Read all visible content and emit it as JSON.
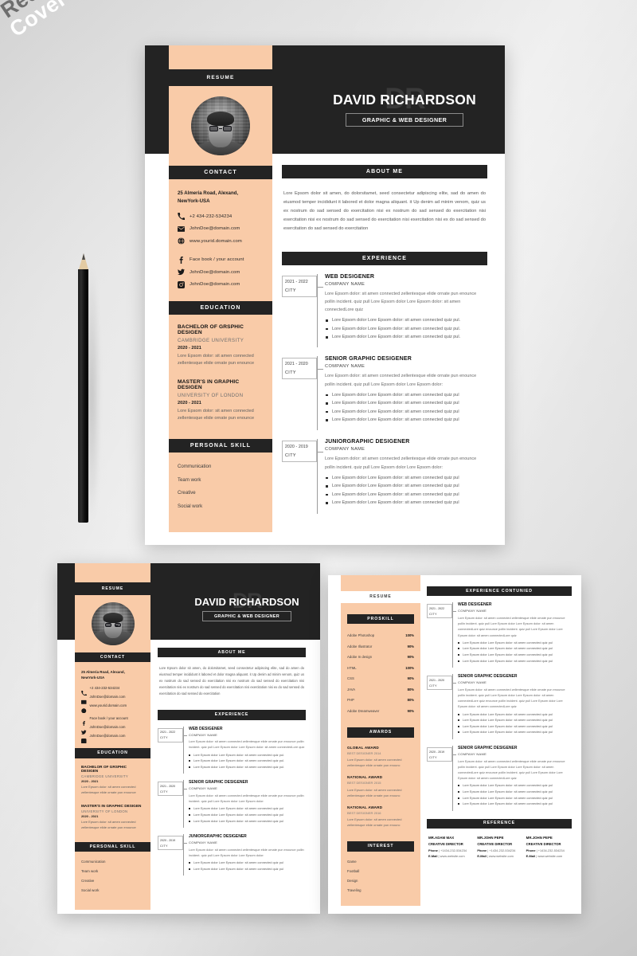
{
  "badge": {
    "line1": "Resume &",
    "line2": "Cover Letter"
  },
  "person": {
    "name": "DAVID RICHARDSON",
    "monogram": "DR",
    "role": "GRAPHIC & WEB DESIGNER",
    "resume_label": "RESUME"
  },
  "sections": {
    "contact": "CONTACT",
    "about": "ABOUT ME",
    "experience": "EXPERIENCE",
    "education": "EDUCATION",
    "personal_skill": "PERSONAL SKILL",
    "proskill": "PROSKILL",
    "awards": "AWARDS",
    "interest": "INTEREST",
    "reference": "REFERENCE",
    "experience_continued": "EXPERIENCE CONTUNIED"
  },
  "contact": {
    "address_line1": "25 Almeria Road, Alexand,",
    "address_line2": "NewYork-USA",
    "phone": "+2 434-232-534234",
    "email": "JohnDoe@domain.com",
    "website": "www.yourid.domain.com",
    "facebook": "Face book / your account",
    "twitter": "JohnDoe@domain.com",
    "instagram": "JohnDoe@domain.com",
    "icons": {
      "phone": "phone-icon",
      "email": "envelope-icon",
      "website": "globe-icon",
      "facebook": "facebook-icon",
      "twitter": "twitter-icon",
      "instagram": "instagram-icon"
    }
  },
  "about_text": "Lore Epsom dolor sit amen, do dolorsitamet, seed consectetur adipiscing elite, sad do amen do eiusmod temper incididunt it labored et dolor magna aliquant. it Up denim ad minim venom, quiz  us ex nostrum do sad   sensed do  exercitation nisi  ex nostrum do sad  sensed do  exercitation nisi exercitation nisi  ex nostrum do sad   sensed do  exercitation nisi  exercitation nisi   ex do sad    sensed do   exercitation do sad    sensed do   exercitation",
  "experience": [
    {
      "years": "2021 - 2022",
      "city": "CITY",
      "title": "WEB DESIGENER",
      "company": "COMPANY NAME",
      "desc": "Lore Epsom dolor: sit amen connected zellentesque elide ornate pun enounce pollin incident. quiz pull Lore Epsom dolor Lore Epsom dolor: sit amen connectedLore quiz",
      "bullets": [
        "Lore Epsom dolor Lore Epsom dolor: sit amen connected  quiz pul.",
        "Lore Epsom dolor Lore Epsom dolor: sit amen connected  quiz pul.",
        "Lore Epsom dolor Lore Epsom dolor: sit amen connected  quiz pul."
      ]
    },
    {
      "years": "2021 - 2020",
      "city": "CITY",
      "title": "SENIOR GRAPHIC DESIGENER",
      "company": "COMPANY NAME",
      "desc": "Lore Epsom dolor: sit amen connected zellentesque elide ornate pun enounce pollin incident. quiz pull Lore Epsom dolor Lore Epsom dolor:",
      "bullets": [
        "Lore Epsom dolor Lore Epsom dolor: sit amen connected  quiz pul",
        "Lore Epsom dolor Lore Epsom dolor: sit amen connected  quiz pul",
        "Lore Epsom dolor Lore Epsom dolor: sit amen connected  quiz pul",
        "Lore Epsom dolor Lore Epsom dolor: sit amen connected  quiz pul"
      ]
    },
    {
      "years": "2020 -  2019",
      "city": "CITY",
      "title": "JUNIORGRAPHIC DESIGENER",
      "company": "COMPANY NAME",
      "desc": "Lore Epsom dolor: sit amen connected zellentesque elide ornate pun enounce pollin incident. quiz pull Lore Epsom dolor Lore Epsom dolor:",
      "bullets": [
        "Lore Epsom dolor Lore Epsom dolor: sit amen connected  quiz pul",
        "Lore Epsom dolor Lore Epsom dolor: sit amen connected  quiz pul",
        "Lore Epsom dolor Lore Epsom dolor: sit amen connected  quiz pul",
        "Lore Epsom dolor Lore Epsom dolor: sit amen connected  quiz pul"
      ]
    }
  ],
  "education": [
    {
      "degree": "BACHELOR OF GRSPHIC DESIGEN",
      "school": "CAMBRIDGE UNIVERSITY",
      "years": "2020 - 2021",
      "desc": "Lore Epsom dolor: sit amen connected zellentesque elide ornate pun enounce"
    },
    {
      "degree": "MASTER'S IN GRAPHIC DESIGEN",
      "school": "UNIVERSITY OF LONDON",
      "years": "2020 - 2021",
      "desc": "Lore Epsom dolor: sit amen connected zellentesque elide ornate pun enounce"
    }
  ],
  "personal_skills": [
    "Communication",
    "Team work",
    "Creative",
    "Social work"
  ],
  "pro_skills": [
    {
      "name": "Adobe Photoshop",
      "pct": "100%"
    },
    {
      "name": "Adobe Illustrator",
      "pct": "90%"
    },
    {
      "name": "Adobe In design",
      "pct": "90%"
    },
    {
      "name": "HTML",
      "pct": "100%"
    },
    {
      "name": "CSS",
      "pct": "90%"
    },
    {
      "name": "JAVA",
      "pct": "80%"
    },
    {
      "name": "PHP",
      "pct": "80%"
    },
    {
      "name": "Adobe Dreamweaver",
      "pct": "90%"
    }
  ],
  "awards": [
    {
      "scope": "GLOBAL AWARD",
      "title": "BEST DESIGNER",
      "year": "2014",
      "desc": "Lore Epsom dolor: sit amen connected zellentesque elide ornate pun enounc"
    },
    {
      "scope": "NATIONAL AWARD",
      "title": "BEST DESIGNER",
      "year": "2015",
      "desc": "Lore Epsom dolor: sit amen connected zellentesque elide ornate pun enounc"
    },
    {
      "scope": "NATIONAL AWARD",
      "title": "BEST DESIGNER",
      "year": "2016",
      "desc": "Lore Epsom dolor: sit amen connected zellentesque elide ornate pun enounc"
    }
  ],
  "interests": [
    "Game",
    "Football",
    "Design",
    "Traveling"
  ],
  "references": [
    {
      "name": "MR.ADAM MAX",
      "role": "CREATIVE DIRECTOR",
      "phone_label": "Phone",
      "phone": "+1434-232-534234",
      "email_label": "E-Mail",
      "email": "www.website.com"
    },
    {
      "name": "MR.JOHN PEPE",
      "role": "CREATIVE DIRECTOR",
      "phone_label": "Phone",
      "phone": "+1434-232-534234",
      "email_label": "E-Mail",
      "email": "www.website.com"
    },
    {
      "name": "MR.JOHN PEPE",
      "role": "CREATIVE DIRECTOR",
      "phone_label": "Phone",
      "phone": "+1434-232-534234",
      "email_label": "E-Mail",
      "email": "www.website.com"
    }
  ],
  "experience_continued": [
    {
      "years": "2021 - 2022",
      "city": "CITY",
      "title": "WEB DESIGENER",
      "company": "COMPANY NAME",
      "desc": "Lore Epsom dolor: sit amen connected zellentesque elide ornate pun enounce pollin incident. quiz pull Lore Epsom dolor Lore Epsom dolor: sit amen connectedLore quiz  enounce pollin incident. quiz pull Lore Epsom dolor Lore Epsom dolor: sit amen connectedLore quiz",
      "bullets": [
        "Lore Epsom dolor Lore Epsom dolor: sit amen connected  quiz pul",
        "Lore Epsom dolor Lore Epsom dolor: sit amen connected  quiz pul",
        "Lore Epsom dolor Lore Epsom dolor: sit amen connected  quiz pul",
        "Lore Epsom dolor Lore Epsom dolor: sit amen connected  quiz pul"
      ]
    },
    {
      "years": "2021 - 2020",
      "city": "CITY",
      "title": "SENIOR GRAPHIC DESIGENER",
      "company": "COMPANY NAME",
      "desc": "Lore Epsom dolor: sit amen connected zellentesque elide ornate pun enounce pollin incident. quiz pull Lore Epsom dolor Lore Epsom dolor: sit amen connectedLore quiz  enounce pollin incident. quiz pull Lore Epsom dolor Lore Epsom dolor: sit amen connectedLore quiz",
      "bullets": [
        "Lore Epsom dolor Lore Epsom dolor: sit amen connected  quiz pul",
        "Lore Epsom dolor Lore Epsom dolor: sit amen connected  quiz pul",
        "Lore Epsom dolor Lore Epsom dolor: sit amen connected  quiz pul",
        "Lore Epsom dolor Lore Epsom dolor: sit amen connected  quiz pul"
      ]
    },
    {
      "years": "2020 - 2019",
      "city": "CITY",
      "title": "SENIOR GRAPHIC DESIGENER",
      "company": "COMPANY NAME",
      "desc": "Lore Epsom dolor: sit amen connected zellentesque elide ornate pun enounce pollin incident. quiz pull Lore Epsom dolor Lore Epsom dolor: sit amen connectedLore quiz  enounce pollin incident. quiz pull Lore Epsom dolor Lore Epsom dolor: sit amen connectedLore quiz",
      "bullets": [
        "Lore Epsom dolor Lore Epsom dolor: sit amen connected  quiz pul",
        "Lore Epsom dolor Lore Epsom dolor: sit amen connected  quiz pul",
        "Lore Epsom dolor Lore Epsom dolor: sit amen connected  quiz pul",
        "Lore Epsom dolor Lore Epsom dolor: sit amen connected  quiz pul"
      ]
    }
  ],
  "colors": {
    "accent_peach": "#F9CBA8",
    "dark": "#232323",
    "paper": "#FFFFFF",
    "backdrop": "#E4E4E4"
  }
}
